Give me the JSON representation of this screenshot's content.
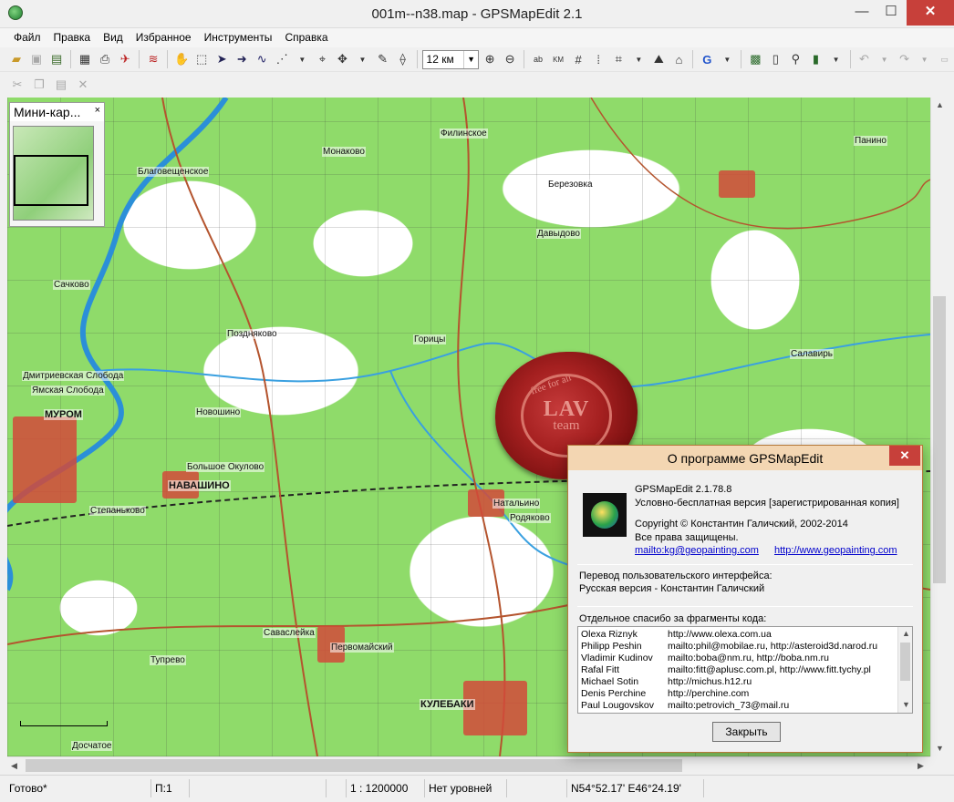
{
  "window": {
    "title": "001m--n38.map - GPSMapEdit 2.1",
    "minimize_glyph": "—",
    "maximize_glyph": "☐",
    "close_glyph": "✕"
  },
  "menu": [
    "Файл",
    "Правка",
    "Вид",
    "Избранное",
    "Инструменты",
    "Справка"
  ],
  "toolbar": {
    "scale_value": "12 км"
  },
  "minimap": {
    "title": "Мини-кар...",
    "close_glyph": "×"
  },
  "map": {
    "labels": [
      "МУРОМ",
      "НАВАШИНО",
      "КУЛЕБАКИ",
      "Благовещенское",
      "Монаково",
      "Березовка",
      "Давыдово",
      "Салавирь",
      "Натальино",
      "Родяково",
      "Новошино",
      "Поздняково",
      "Дмитриевская Слобода",
      "Ямская Слобода",
      "Большое Окулово",
      "Саваслейка",
      "Первомайский",
      "Тупрево",
      "Досчатое",
      "Филинское",
      "Панино",
      "Сачково",
      "Степаньково",
      "Горицы"
    ],
    "seal": {
      "ring_text": "free for all",
      "main_text": "LAV",
      "sub_text": "team"
    }
  },
  "dialog": {
    "title": "О программе GPSMapEdit",
    "close_glyph": "✕",
    "version": "GPSMapEdit 2.1.78.8",
    "license": "Условно-бесплатная версия [зарегистрированная копия]",
    "copyright": "Copyright © Константин Галичский, 2002-2014",
    "rights": "Все права защищены.",
    "email_link": "mailto:kg@geopainting.com",
    "web_link": "http://www.geopainting.com",
    "translation_heading": "Перевод пользовательского интерфейса:",
    "translation_value": "Русская версия - Константин Галичский",
    "credits_heading": "Отдельное спасибо за фрагменты кода:",
    "credits": [
      {
        "name": "Olexa Riznyk",
        "contact": "http://www.olexa.com.ua"
      },
      {
        "name": "Philipp Peshin",
        "contact": "mailto:phil@mobilae.ru, http://asteroid3d.narod.ru"
      },
      {
        "name": "Vladimir Kudinov",
        "contact": "mailto:boba@nm.ru, http://boba.nm.ru"
      },
      {
        "name": "Rafal Fitt",
        "contact": "mailto:fitt@aplusc.com.pl, http://www.fitt.tychy.pl"
      },
      {
        "name": "Michael Sotin",
        "contact": "http://michus.h12.ru"
      },
      {
        "name": "Denis Perchine",
        "contact": "http://perchine.com"
      },
      {
        "name": "Paul Lougovskov",
        "contact": "mailto:petrovich_73@mail.ru"
      }
    ],
    "close_button": "Закрыть"
  },
  "status": {
    "ready": "Готово*",
    "points": "П:1",
    "scale": "1 : 1200000",
    "levels": "Нет уровней",
    "coords": "N54°52.17' E46°24.19'"
  },
  "colors": {
    "forest": "#8fdb6a",
    "road": "#b4542e",
    "town": "#d24a3a",
    "dialog_titlebar": "#f3d6b2",
    "close_red": "#c7403a",
    "link": "#0000cc"
  }
}
